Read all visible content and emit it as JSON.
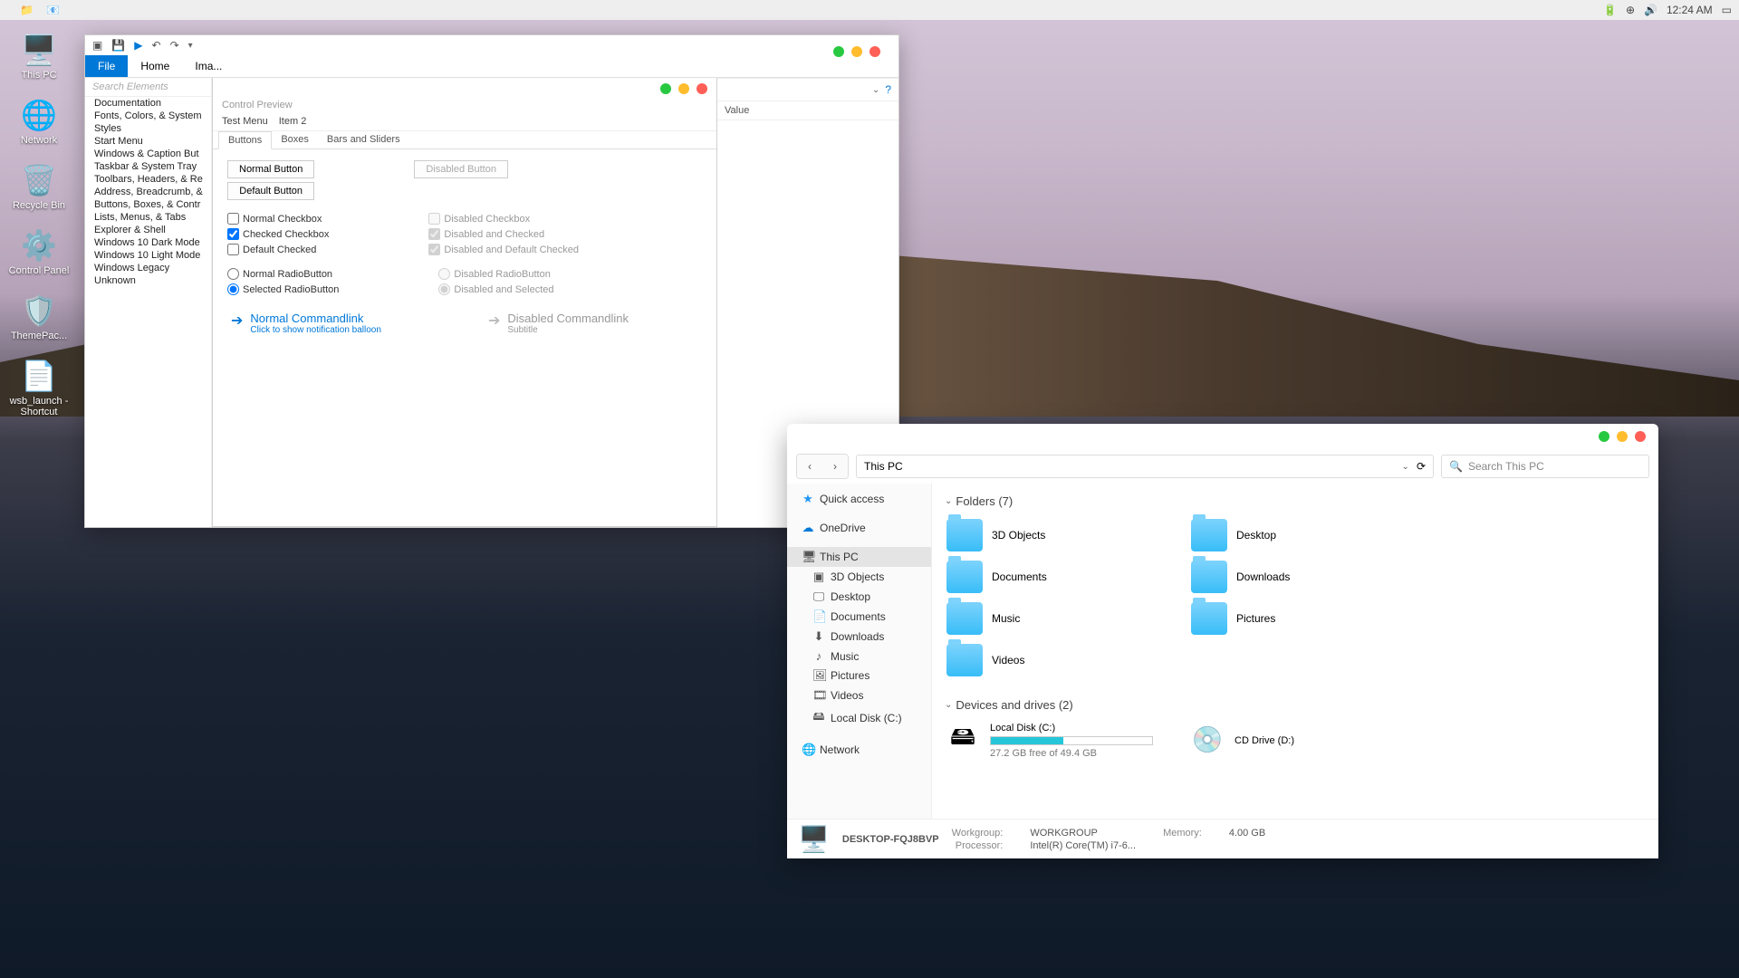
{
  "menubar": {
    "time": "12:24 AM"
  },
  "desktop": {
    "icons": [
      {
        "label": "This PC",
        "glyph": "🖥️"
      },
      {
        "label": "Network",
        "glyph": "🌐"
      },
      {
        "label": "Recycle Bin",
        "glyph": "🗑️"
      },
      {
        "label": "Control Panel",
        "glyph": "⚙️"
      },
      {
        "label": "ThemePac...",
        "glyph": "🛡️"
      },
      {
        "label": "wsb_launch - Shortcut",
        "glyph": "📄"
      }
    ]
  },
  "windowA": {
    "ribbon": {
      "file": "File",
      "home": "Home",
      "image": "Ima..."
    },
    "search_placeholder": "Search Elements",
    "sidebar": [
      "Documentation",
      "Fonts, Colors, & System",
      "Styles",
      "Start Menu",
      "Windows & Caption But",
      "Taskbar & System Tray",
      "Toolbars, Headers, & Re",
      "Address, Breadcrumb, &",
      "Buttons, Boxes, & Contr",
      "Lists, Menus, & Tabs",
      "Explorer & Shell",
      "Windows 10 Dark Mode",
      "Windows 10 Light Mode",
      "Windows Legacy",
      "Unknown"
    ],
    "preview": {
      "title": "Control Preview",
      "menu": [
        "Test Menu",
        "Item 2"
      ],
      "subtabs": [
        "Buttons",
        "Boxes",
        "Bars and Sliders"
      ],
      "buttons": {
        "normal": "Normal Button",
        "default": "Default Button",
        "disabled": "Disabled Button"
      },
      "checks": {
        "normal": "Normal Checkbox",
        "checked": "Checked Checkbox",
        "defchecked": "Default Checked",
        "disabled": "Disabled Checkbox",
        "dischecked": "Disabled and Checked",
        "disdef": "Disabled and Default Checked"
      },
      "radios": {
        "normal": "Normal RadioButton",
        "selected": "Selected RadioButton",
        "disabled": "Disabled RadioButton",
        "dissel": "Disabled and Selected"
      },
      "cmdlink": {
        "title": "Normal Commandlink",
        "sub": "Click to show notification balloon",
        "dtitle": "Disabled Commandlink",
        "dsub": "Subtitle"
      }
    },
    "right_pane": {
      "header": "Value"
    }
  },
  "windowB": {
    "address": "This PC",
    "search_placeholder": "Search This PC",
    "nav": {
      "quick": "Quick access",
      "onedrive": "OneDrive",
      "thispc": "This PC",
      "sub": [
        "3D Objects",
        "Desktop",
        "Documents",
        "Downloads",
        "Music",
        "Pictures",
        "Videos",
        "Local Disk (C:)"
      ],
      "network": "Network"
    },
    "groups": {
      "folders_header": "Folders (7)",
      "folders": [
        "3D Objects",
        "Desktop",
        "Documents",
        "Downloads",
        "Music",
        "Pictures",
        "Videos"
      ],
      "drives_header": "Devices and drives (2)",
      "disk": {
        "name": "Local Disk (C:)",
        "free": "27.2 GB free of 49.4 GB",
        "fill_pct": 45
      },
      "cd": {
        "name": "CD Drive (D:)"
      }
    },
    "status": {
      "hostname": "DESKTOP-FQJ8BVP",
      "workgroup_l": "Workgroup:",
      "workgroup_v": "WORKGROUP",
      "processor_l": "Processor:",
      "processor_v": "Intel(R) Core(TM) i7-6...",
      "memory_l": "Memory:",
      "memory_v": "4.00 GB"
    }
  }
}
